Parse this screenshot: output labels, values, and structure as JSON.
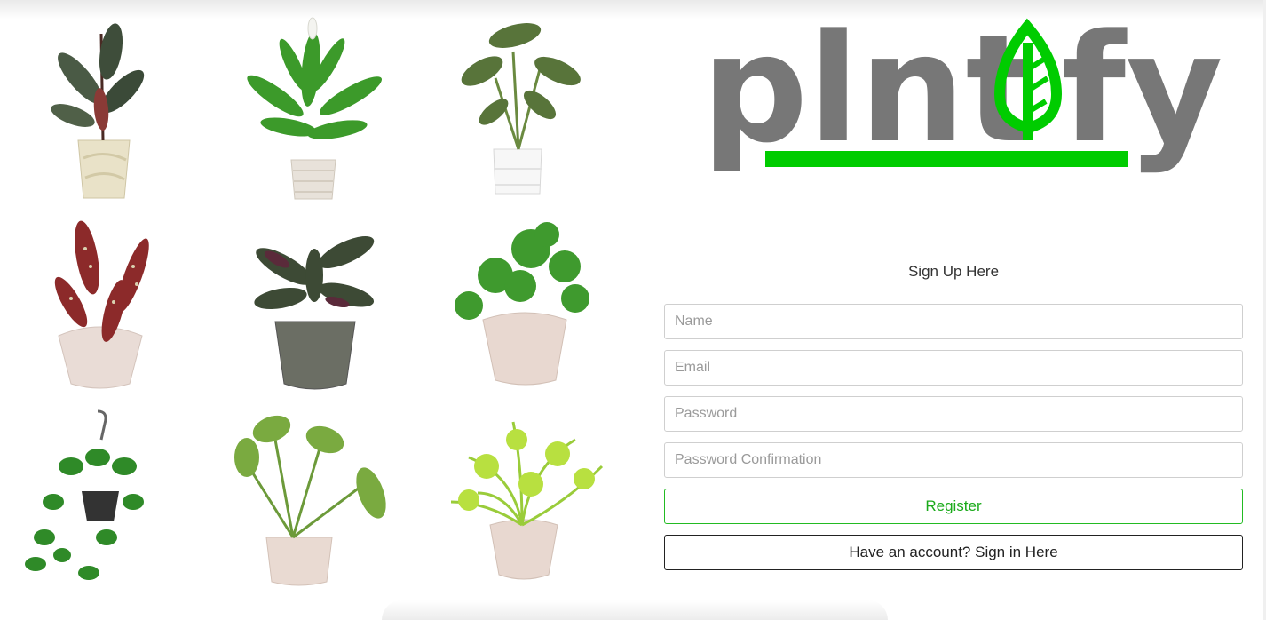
{
  "logo": {
    "letters_left": "plnt",
    "letters_right": "fy",
    "icon": "leaf-icon",
    "brand_green": "#00cc00",
    "brand_gray": "#777777"
  },
  "plants": [
    {
      "name": "rubber-plant",
      "icon": "plant-image"
    },
    {
      "name": "peace-lily",
      "icon": "plant-image"
    },
    {
      "name": "monstera",
      "icon": "plant-image"
    },
    {
      "name": "polka-dot-begonia",
      "icon": "plant-image"
    },
    {
      "name": "calathea",
      "icon": "plant-image"
    },
    {
      "name": "pilea",
      "icon": "plant-image"
    },
    {
      "name": "hanging-pothos",
      "icon": "plant-image"
    },
    {
      "name": "alocasia",
      "icon": "plant-image"
    },
    {
      "name": "asparagus-fern",
      "icon": "plant-image"
    }
  ],
  "form": {
    "title": "Sign Up Here",
    "name_placeholder": "Name",
    "email_placeholder": "Email",
    "password_placeholder": "Password",
    "password_confirmation_placeholder": "Password Confirmation",
    "register_label": "Register",
    "signin_label": "Have an account? Sign in Here"
  }
}
